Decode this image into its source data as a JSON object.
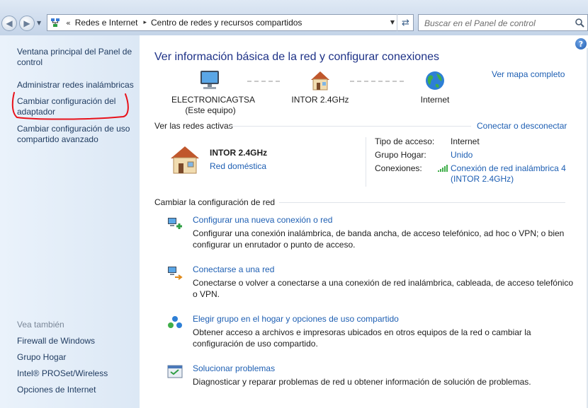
{
  "address_bar": {
    "chevrons": "«",
    "crumbs": [
      "Redes e Internet",
      "Centro de redes y recursos compartidos"
    ],
    "separator": "▸",
    "search_placeholder": "Buscar en el Panel de control"
  },
  "sidebar": {
    "links": [
      "Ventana principal del Panel de control",
      "Administrar redes inalámbricas",
      "Cambiar configuración del adaptador",
      "Cambiar configuración de uso compartido avanzado"
    ],
    "see_also_heading": "Vea también",
    "see_also": [
      "Firewall de Windows",
      "Grupo Hogar",
      "Intel® PROSet/Wireless",
      "Opciones de Internet"
    ]
  },
  "main": {
    "title": "Ver información básica de la red y configurar conexiones",
    "full_map_link": "Ver mapa completo",
    "map_nodes": [
      {
        "label": "ELECTRONICAGTSA",
        "sublabel": "(Este equipo)",
        "icon": "computer-icon"
      },
      {
        "label": "INTOR 2.4GHz",
        "icon": "house-icon"
      },
      {
        "label": "Internet",
        "icon": "globe-icon"
      }
    ],
    "active_networks_heading": "Ver las redes activas",
    "connect_disconnect_link": "Conectar o desconectar",
    "active_network": {
      "name": "INTOR 2.4GHz",
      "type": "Red doméstica",
      "access_type_label": "Tipo de acceso:",
      "access_type_value": "Internet",
      "homegroup_label": "Grupo Hogar:",
      "homegroup_value": "Unido",
      "connections_label": "Conexiones:",
      "connections_value": "Conexión de red inalámbrica 4 (INTOR 2.4GHz)"
    },
    "change_settings_heading": "Cambiar la configuración de red",
    "tasks": [
      {
        "link": "Configurar una nueva conexión o red",
        "description": "Configurar una conexión inalámbrica, de banda ancha, de acceso telefónico, ad hoc o VPN; o bien configurar un enrutador o punto de acceso.",
        "icon": "new-connection-icon"
      },
      {
        "link": "Conectarse a una red",
        "description": "Conectarse o volver a conectarse a una conexión de red inalámbrica, cableada, de acceso telefónico o VPN.",
        "icon": "connect-network-icon"
      },
      {
        "link": "Elegir grupo en el hogar y opciones de uso compartido",
        "description": "Obtener acceso a archivos e impresoras ubicados en otros equipos de la red o cambiar la configuración de uso compartido.",
        "icon": "homegroup-icon"
      },
      {
        "link": "Solucionar problemas",
        "description": "Diagnosticar y reparar problemas de red u obtener información de solución de problemas.",
        "icon": "troubleshoot-icon"
      }
    ]
  },
  "colors": {
    "link": "#1e5fb3",
    "title": "#1e3287",
    "sidebar_link": "#1e3a5f",
    "annotation": "#e8121b"
  }
}
